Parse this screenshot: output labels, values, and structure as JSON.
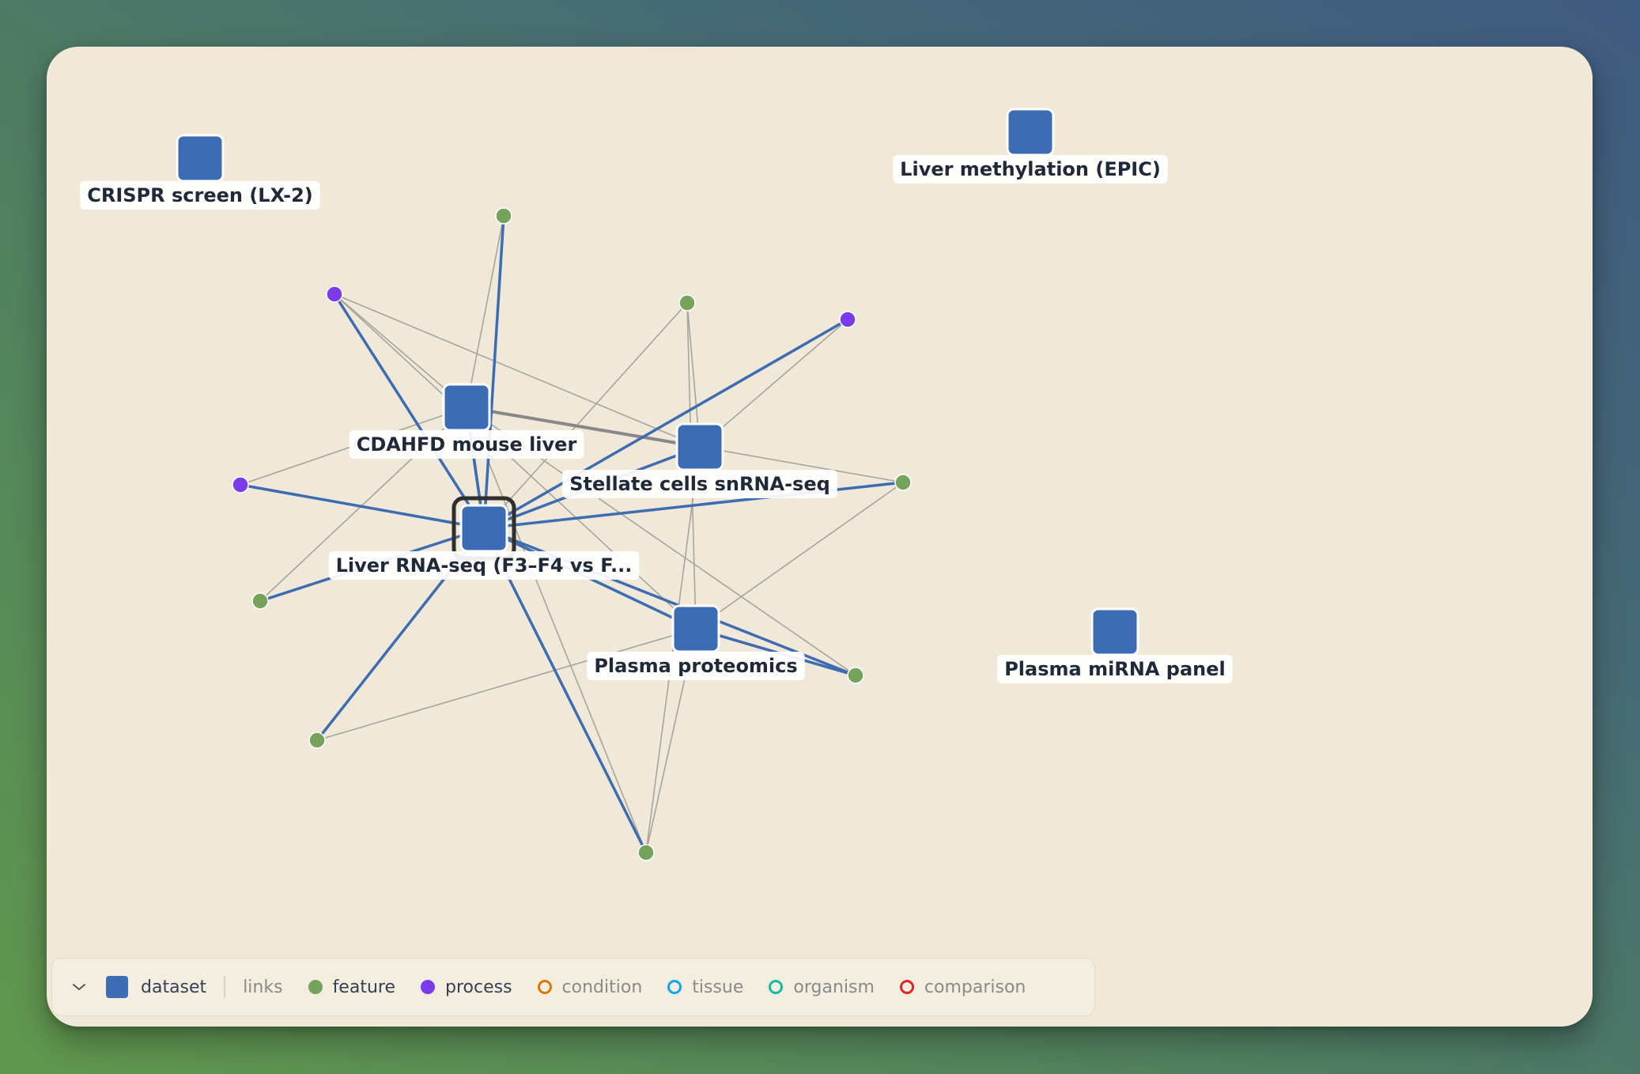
{
  "graph": {
    "colors": {
      "dataset": "#3b6cb4",
      "feature": "#76a35b",
      "process": "#7b3bea",
      "condition": "#d97706",
      "tissue": "#0ea5e9",
      "organism": "#14b8a6",
      "comparison": "#dc2626",
      "edge_dataset": "#3e6cb0",
      "edge_other": "#a9a49a",
      "edge_strong": "#888888",
      "selected_ring": "#2f2f2f"
    },
    "datasets": [
      {
        "id": "crispr",
        "label": "CRISPR screen (LX-2)"
      },
      {
        "id": "methyl",
        "label": "Liver methylation (EPIC)"
      },
      {
        "id": "cdahfd",
        "label": "CDAHFD mouse liver"
      },
      {
        "id": "stellate",
        "label": "Stellate cells snRNA-seq"
      },
      {
        "id": "liverrna",
        "label": "Liver RNA-seq (F3–F4 vs F...",
        "selected": true
      },
      {
        "id": "plasmaprot",
        "label": "Plasma proteomics"
      },
      {
        "id": "mirna",
        "label": "Plasma miRNA panel"
      }
    ]
  },
  "legend": {
    "collapse_icon": "chevron-down-icon",
    "items": [
      {
        "key": "dataset",
        "label": "dataset",
        "active": true
      },
      {
        "key": "links",
        "label": "links",
        "active": false
      },
      {
        "key": "feature",
        "label": "feature",
        "active": true
      },
      {
        "key": "process",
        "label": "process",
        "active": true
      },
      {
        "key": "condition",
        "label": "condition",
        "active": false
      },
      {
        "key": "tissue",
        "label": "tissue",
        "active": false
      },
      {
        "key": "organism",
        "label": "organism",
        "active": false
      },
      {
        "key": "comparison",
        "label": "comparison",
        "active": false
      }
    ]
  }
}
